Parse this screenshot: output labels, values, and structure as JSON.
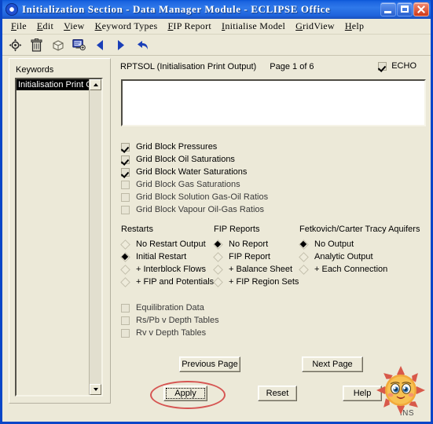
{
  "window": {
    "title": "Initialization Section - Data Manager Module - ECLIPSE Office",
    "app_icon": "eclipse-office-icon",
    "controls": {
      "minimize": "Minimize",
      "maximize": "Maximize",
      "close": "Close"
    },
    "accent_color": "#2f79ea",
    "face_color": "#ece9d8"
  },
  "menubar": {
    "items": [
      {
        "mnemonic": "F",
        "rest": "ile"
      },
      {
        "mnemonic": "E",
        "rest": "dit"
      },
      {
        "mnemonic": "V",
        "rest": "iew"
      },
      {
        "mnemonic": "K",
        "rest": "eyword Types"
      },
      {
        "mnemonic": "F",
        "rest": "IP Report"
      },
      {
        "mnemonic": "I",
        "rest": "nitialise Model"
      },
      {
        "mnemonic": "G",
        "rest": "ridView"
      },
      {
        "mnemonic": "H",
        "rest": "elp"
      }
    ]
  },
  "toolbar": {
    "buttons": [
      {
        "icon": "target-crosshair-icon",
        "tooltip": "Locate"
      },
      {
        "icon": "trash-bin-icon",
        "tooltip": "Delete"
      },
      {
        "icon": "cube-icon",
        "tooltip": "3D Box"
      },
      {
        "icon": "monitor-icon",
        "tooltip": "Display"
      },
      {
        "icon": "arrow-left-icon",
        "tooltip": "Previous"
      },
      {
        "icon": "arrow-right-icon",
        "tooltip": "Next"
      },
      {
        "icon": "undo-arrow-icon",
        "tooltip": "Undo"
      }
    ]
  },
  "sidebar": {
    "label": "Keywords",
    "items": [
      {
        "label": "Initialisation Print Output",
        "selected": true
      }
    ],
    "scrollbar": {
      "up_arrow": "scroll-up-icon",
      "down_arrow": "scroll-down-icon"
    }
  },
  "main": {
    "header": {
      "keyword": "RPTSOL (Initialisation Print Output)",
      "page": "Page 1 of 6"
    },
    "echo": {
      "label": "ECHO",
      "checked": true
    },
    "memo": {
      "value": "",
      "placeholder": ""
    },
    "grid_block_options": [
      {
        "label": "Grid Block Pressures",
        "checked": true,
        "enabled": true
      },
      {
        "label": "Grid Block Oil Saturations",
        "checked": true,
        "enabled": true
      },
      {
        "label": "Grid Block Water Saturations",
        "checked": true,
        "enabled": true
      },
      {
        "label": "Grid Block Gas Saturations",
        "checked": false,
        "enabled": false
      },
      {
        "label": "Grid Block Solution Gas-Oil Ratios",
        "checked": false,
        "enabled": false
      },
      {
        "label": "Grid Block Vapour Oil-Gas Ratios",
        "checked": false,
        "enabled": false
      }
    ],
    "radio_groups": [
      {
        "title": "Restarts",
        "options": [
          {
            "label": "No Restart Output",
            "selected": false
          },
          {
            "label": "Initial Restart",
            "selected": true
          },
          {
            "label": "+ Interblock Flows",
            "selected": false
          },
          {
            "label": "+ FIP and Potentials",
            "selected": false
          }
        ]
      },
      {
        "title": "FIP Reports",
        "options": [
          {
            "label": "No Report",
            "selected": true
          },
          {
            "label": "FIP Report",
            "selected": false
          },
          {
            "label": "+ Balance Sheet",
            "selected": false
          },
          {
            "label": "+ FIP Region Sets",
            "selected": false
          }
        ]
      },
      {
        "title": "Fetkovich/Carter Tracy Aquifers",
        "options": [
          {
            "label": "No Output",
            "selected": true
          },
          {
            "label": "Analytic Output",
            "selected": false
          },
          {
            "label": "+ Each Connection",
            "selected": false
          }
        ]
      }
    ],
    "table_options": [
      {
        "label": "Equilibration Data",
        "checked": false
      },
      {
        "label": "Rs/Pb v Depth Tables",
        "checked": false
      },
      {
        "label": "Rv v Depth Tables",
        "checked": false
      }
    ],
    "buttons": {
      "previous_page": "Previous Page",
      "next_page": "Next Page",
      "apply": "Apply",
      "reset": "Reset",
      "help": "Help"
    },
    "annotation": {
      "target": "apply-button",
      "shape": "ellipse",
      "color": "#d23b3b"
    }
  },
  "watermark": {
    "icon": "sun-face-icon",
    "text": "INS",
    "colors": {
      "body": "#f6b23c",
      "rays": "#d8594a"
    }
  }
}
